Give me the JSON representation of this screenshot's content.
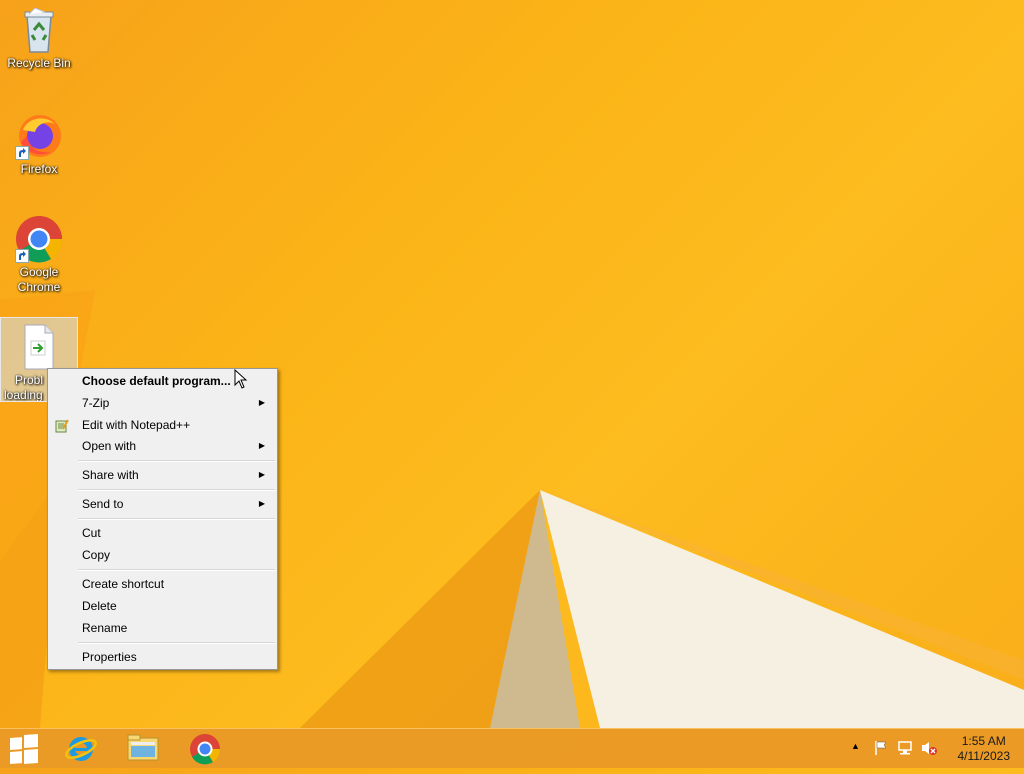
{
  "desktop": {
    "icons": [
      {
        "label": "Recycle Bin",
        "icon": "recycle-bin-icon"
      },
      {
        "label": "Firefox",
        "icon": "firefox-icon"
      },
      {
        "label_line1": "Google",
        "label_line2": "Chrome",
        "icon": "chrome-icon"
      },
      {
        "label_line1": "Probl",
        "label_line2": "loading",
        "icon": "file-icon"
      }
    ]
  },
  "context_menu": {
    "items": [
      {
        "label": "Choose default program...",
        "bold": true
      },
      {
        "label": "7-Zip",
        "submenu": true
      },
      {
        "label": "Edit with Notepad++",
        "icon": "notepad-plus-plus-icon"
      },
      {
        "label": "Open with",
        "submenu": true
      },
      {
        "label": "Share with",
        "submenu": true
      },
      {
        "label": "Send to",
        "submenu": true
      },
      {
        "label": "Cut"
      },
      {
        "label": "Copy"
      },
      {
        "label": "Create shortcut"
      },
      {
        "label": "Delete"
      },
      {
        "label": "Rename"
      },
      {
        "label": "Properties"
      }
    ],
    "submenu_arrow": "▶"
  },
  "taskbar": {
    "pinned": [
      "windows-start-icon",
      "internet-explorer-icon",
      "file-explorer-icon",
      "chrome-icon"
    ],
    "tray": [
      "show-hidden-icons-icon",
      "action-center-flag-icon",
      "network-icon",
      "volume-muted-icon"
    ],
    "tray_chevron": "▲",
    "time": "1:55 AM",
    "date": "4/11/2023"
  },
  "colors": {
    "wallpaper": "#fbb417",
    "taskbar": "#e89826",
    "menu_bg": "#f0f0f0"
  }
}
